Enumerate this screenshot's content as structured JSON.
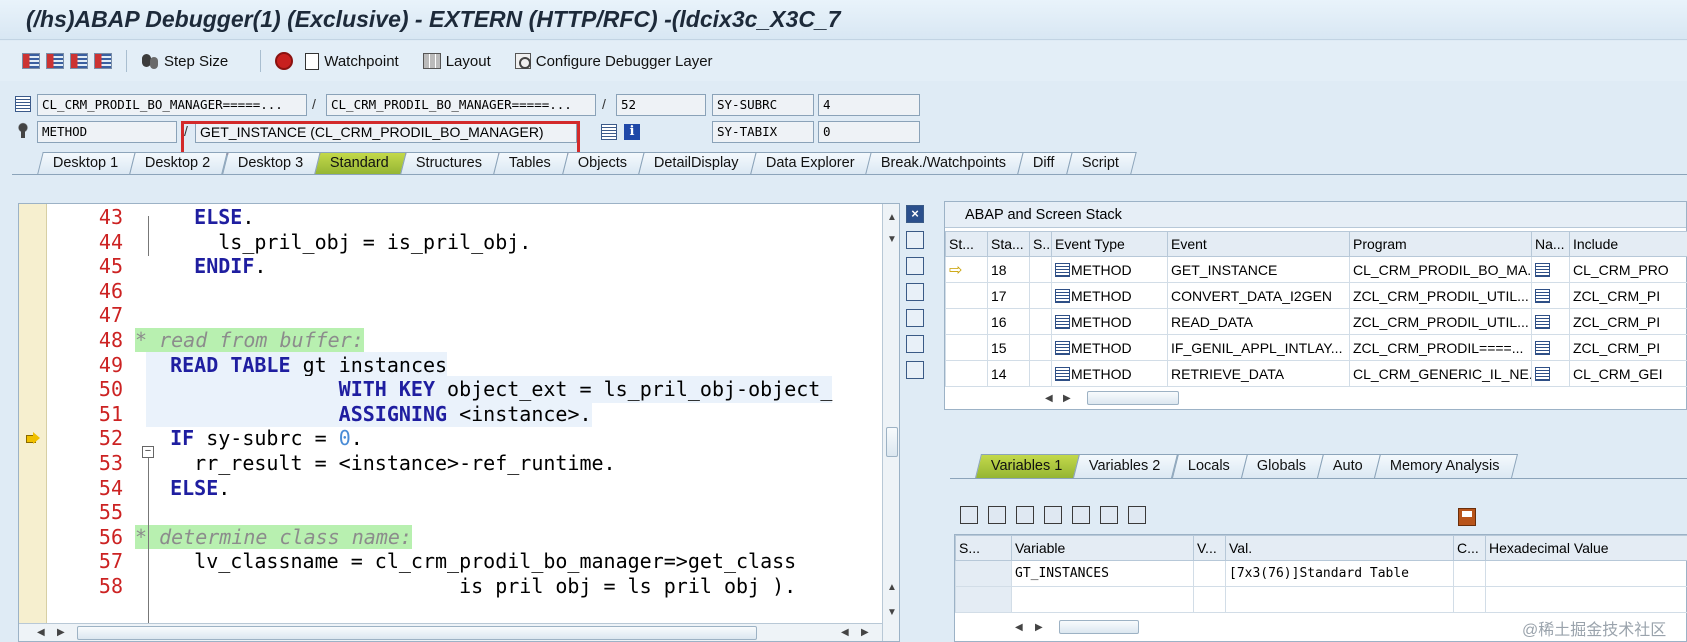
{
  "window": {
    "title": "(/hs)ABAP Debugger(1)  (Exclusive) - EXTERN (HTTP/RFC) -(ldcix3c_X3C_7"
  },
  "toolbar": {
    "step_size": "Step Size",
    "watchpoint": "Watchpoint",
    "layout": "Layout",
    "configure": "Configure Debugger Layer"
  },
  "info": {
    "row1": {
      "program": "CL_CRM_PRODIL_BO_MANAGER=====...",
      "include": "CL_CRM_PRODIL_BO_MANAGER=====...",
      "line": "52",
      "sys_field": "SY-SUBRC",
      "sys_value": "4"
    },
    "row2": {
      "type": "METHOD",
      "event": "GET_INSTANCE (CL_CRM_PRODIL_BO_MANAGER)",
      "sys_field": "SY-TABIX",
      "sys_value": "0"
    }
  },
  "tabs": [
    "Desktop 1",
    "Desktop 2",
    "Desktop 3",
    "Standard",
    "Structures",
    "Tables",
    "Objects",
    "DetailDisplay",
    "Data Explorer",
    "Break./Watchpoints",
    "Diff",
    "Script"
  ],
  "active_tab": "Standard",
  "code": [
    {
      "n": "43",
      "text": "ELSE."
    },
    {
      "n": "44",
      "text": "ls_pril_obj = is_pril_obj."
    },
    {
      "n": "45",
      "text": "ENDIF."
    },
    {
      "n": "46",
      "text": ""
    },
    {
      "n": "47",
      "text": ""
    },
    {
      "n": "48",
      "text": "* read from buffer:"
    },
    {
      "n": "49",
      "text": "READ TABLE gt_instances"
    },
    {
      "n": "50",
      "text": "WITH KEY object_ext = ls_pril_obj-object_"
    },
    {
      "n": "51",
      "text": "ASSIGNING <instance>."
    },
    {
      "n": "52",
      "text": "IF sy-subrc = 0."
    },
    {
      "n": "53",
      "text": "rr_result = <instance>-ref_runtime."
    },
    {
      "n": "54",
      "text": "ELSE."
    },
    {
      "n": "55",
      "text": ""
    },
    {
      "n": "56",
      "text": "* determine class name:"
    },
    {
      "n": "57",
      "text": "lv_classname = cl_crm_prodil_bo_manager=>get_class"
    },
    {
      "n": "58",
      "text": "is pril obj = ls pril obj )."
    }
  ],
  "stack": {
    "title": "ABAP and Screen Stack",
    "columns": [
      "St...",
      "Sta...",
      "S..",
      "Event Type",
      "Event",
      "Program",
      "Na...",
      "Include"
    ],
    "rows": [
      {
        "level": "18",
        "type": "METHOD",
        "event": "GET_INSTANCE",
        "program": "CL_CRM_PRODIL_BO_MA...",
        "include": "CL_CRM_PRO"
      },
      {
        "level": "17",
        "type": "METHOD",
        "event": "CONVERT_DATA_I2GEN",
        "program": "ZCL_CRM_PRODIL_UTIL...",
        "include": "ZCL_CRM_PI"
      },
      {
        "level": "16",
        "type": "METHOD",
        "event": "READ_DATA",
        "program": "ZCL_CRM_PRODIL_UTIL...",
        "include": "ZCL_CRM_PI"
      },
      {
        "level": "15",
        "type": "METHOD",
        "event": "IF_GENIL_APPL_INTLAY...",
        "program": "ZCL_CRM_PRODIL====...",
        "include": "ZCL_CRM_PI"
      },
      {
        "level": "14",
        "type": "METHOD",
        "event": "RETRIEVE_DATA",
        "program": "CL_CRM_GENERIC_IL_NE...",
        "include": "CL_CRM_GEI"
      }
    ]
  },
  "var_tabs": [
    "Variables 1",
    "Variables 2",
    "Locals",
    "Globals",
    "Auto",
    "Memory Analysis"
  ],
  "active_var_tab": "Variables 1",
  "vars": {
    "columns": [
      "S...",
      "Variable",
      "V...",
      "Val.",
      "C...",
      "Hexadecimal Value"
    ],
    "rows": [
      {
        "variable": "GT_INSTANCES",
        "value": "[7x3(76)]Standard Table"
      }
    ]
  },
  "watermark": "@稀土掘金技术社区",
  "colors": {
    "active_tab": "#a8c53c",
    "highlight": "#d32a2a"
  }
}
